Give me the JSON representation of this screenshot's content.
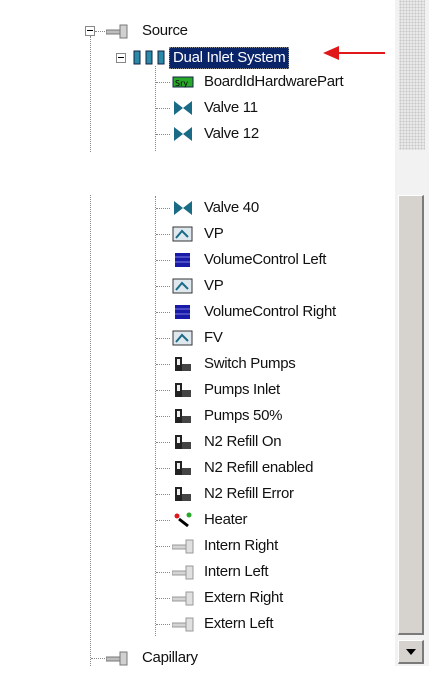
{
  "tree": {
    "source": "Source",
    "dual_inlet": "Dual Inlet System",
    "items_top": [
      "BoardIdHardwarePart",
      "Valve 11",
      "Valve 12"
    ],
    "items_bottom": [
      "Valve 40",
      "VP",
      "VolumeControl Left",
      "VP",
      "VolumeControl Right",
      "FV",
      "Switch Pumps",
      "Pumps Inlet",
      "Pumps 50%",
      "N2 Refill On",
      "N2 Refill enabled",
      "N2 Refill Error",
      "Heater",
      "Intern Right",
      "Intern Left",
      "Extern Right",
      "Extern Left"
    ],
    "capillary": "Capillary"
  },
  "colors": {
    "selection": "#0a246a",
    "arrow": "#e0181a",
    "valve": "#1a6b86",
    "volume": "#1a1aa8"
  }
}
